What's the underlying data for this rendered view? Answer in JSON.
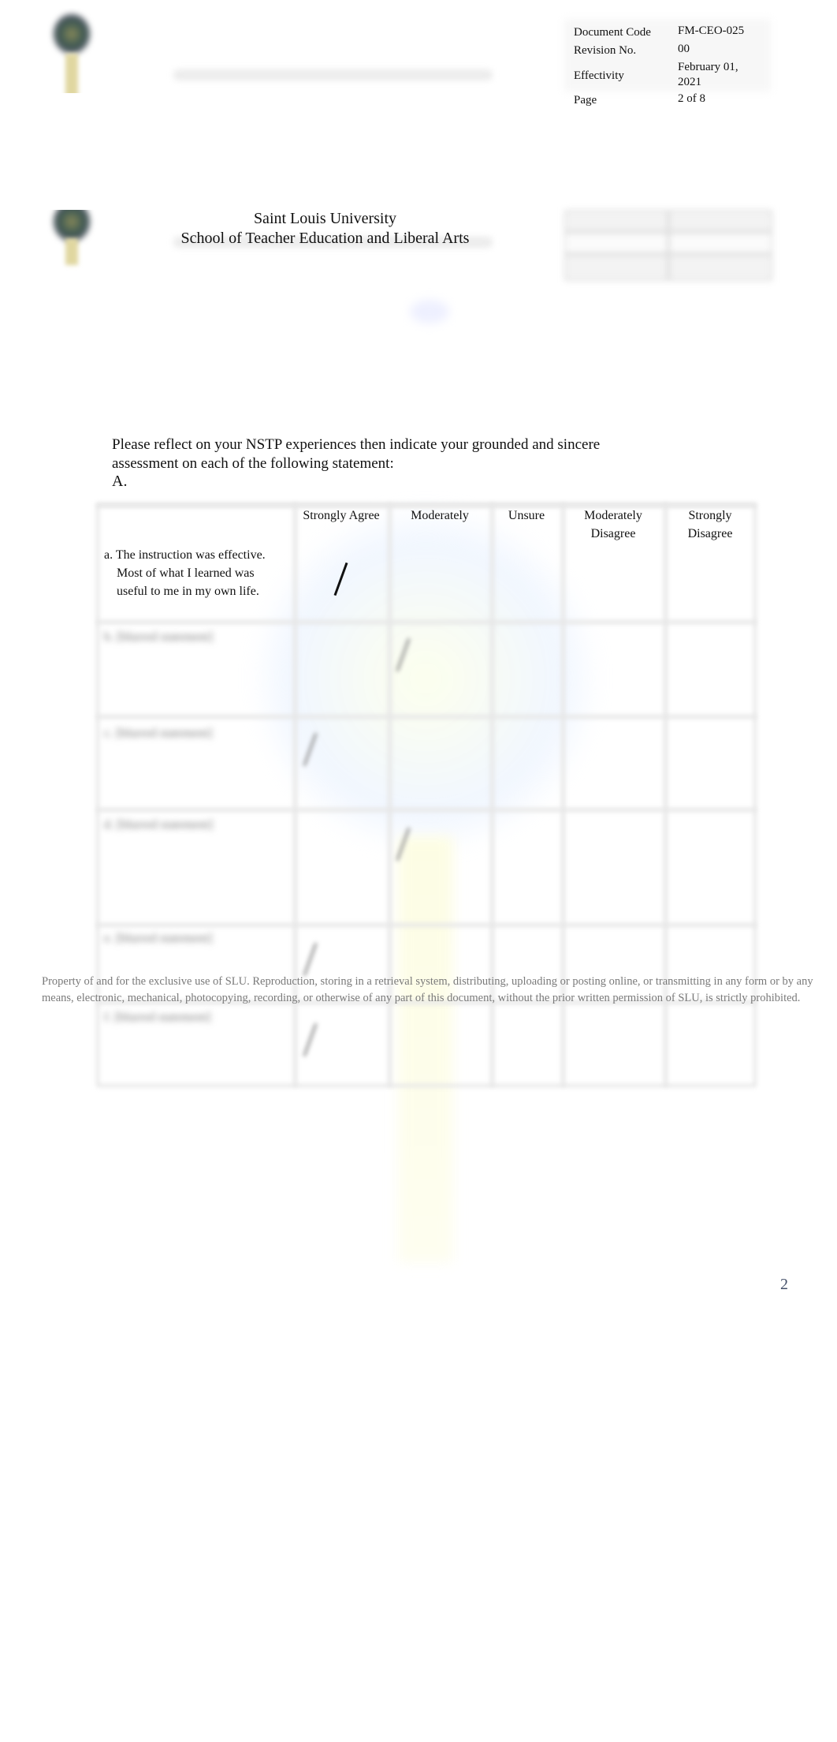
{
  "header": {
    "university": "Saint Louis University",
    "school": "School of Teacher Education and Liberal Arts",
    "doc_info": [
      {
        "label": "Document Code",
        "value": "FM-CEO-025"
      },
      {
        "label": "Revision No.",
        "value": "00"
      },
      {
        "label": "Effectivity",
        "value": "February 01, 2021"
      },
      {
        "label": "Page",
        "value": "2 of 8"
      }
    ]
  },
  "instructions": {
    "text_line1": "Please reflect on your NSTP experiences then indicate your grounded and sincere",
    "text_line2": "assessment on each of the following statement:",
    "section": "A."
  },
  "survey_table": {
    "columns": [
      "",
      "Strongly Agree",
      "Moderately",
      "Unsure",
      "Moderately Disagree",
      "Strongly Disagree"
    ],
    "rows": [
      {
        "statement": "a. The instruction was effective. Most of what I learned was useful to me in my own life.",
        "checked_column": "Strongly Agree",
        "legible": true
      },
      {
        "statement": "b. [blurred statement]",
        "checked_column": "Moderately",
        "legible": false
      },
      {
        "statement": "c. [blurred statement]",
        "checked_column": "Strongly Agree",
        "legible": false
      },
      {
        "statement": "d. [blurred statement]",
        "checked_column": "Moderately",
        "legible": false
      },
      {
        "statement": "e. [blurred statement]",
        "checked_column": "Strongly Agree",
        "legible": false
      },
      {
        "statement": "f. [blurred statement]",
        "checked_column": "Strongly Agree",
        "legible": false
      }
    ],
    "check_mark": "/"
  },
  "footer": {
    "notice_line1": "Property of and for the exclusive use of SLU. Reproduction, storing in a retrieval system, distributing, uploading or posting online, or transmitting in any form or by any",
    "notice_line2": "means, electronic, mechanical, photocopying, recording, or otherwise of any part of this document, without the prior written permission of SLU, is strictly prohibited.",
    "page_number": "2"
  }
}
